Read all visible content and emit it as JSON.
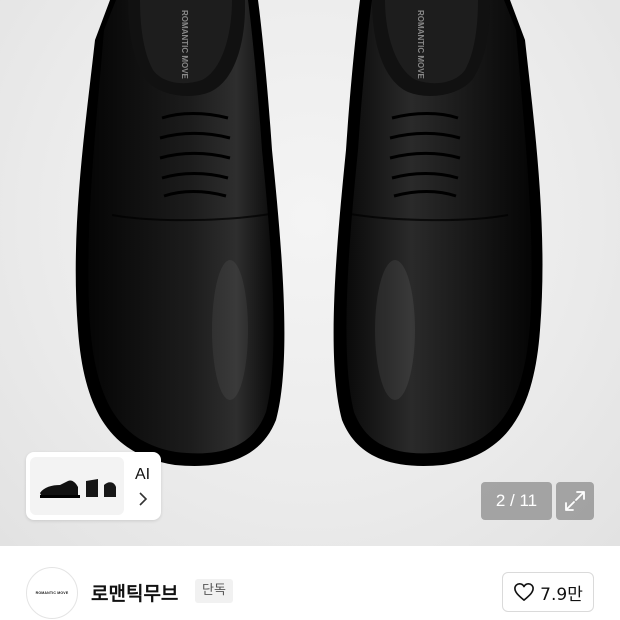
{
  "gallery": {
    "current_index": "2",
    "separator": "/",
    "total": "11",
    "counter_text": "2 / 11",
    "expand_icon": "expand-arrows-icon"
  },
  "shoe_print": "ROMANTIC MOVE",
  "ai_chip": {
    "label": "AI",
    "chevron_icon": "chevron-right-icon"
  },
  "brand": {
    "logo_text": "ROMANTIC MOVE",
    "name": "로맨틱무브",
    "badge": "단독"
  },
  "like": {
    "icon": "heart-outline-icon",
    "count": "7.9만"
  },
  "colors": {
    "shoe": "#0d0d0d",
    "background": "#ececec",
    "overlay": "#8c8c8c"
  }
}
